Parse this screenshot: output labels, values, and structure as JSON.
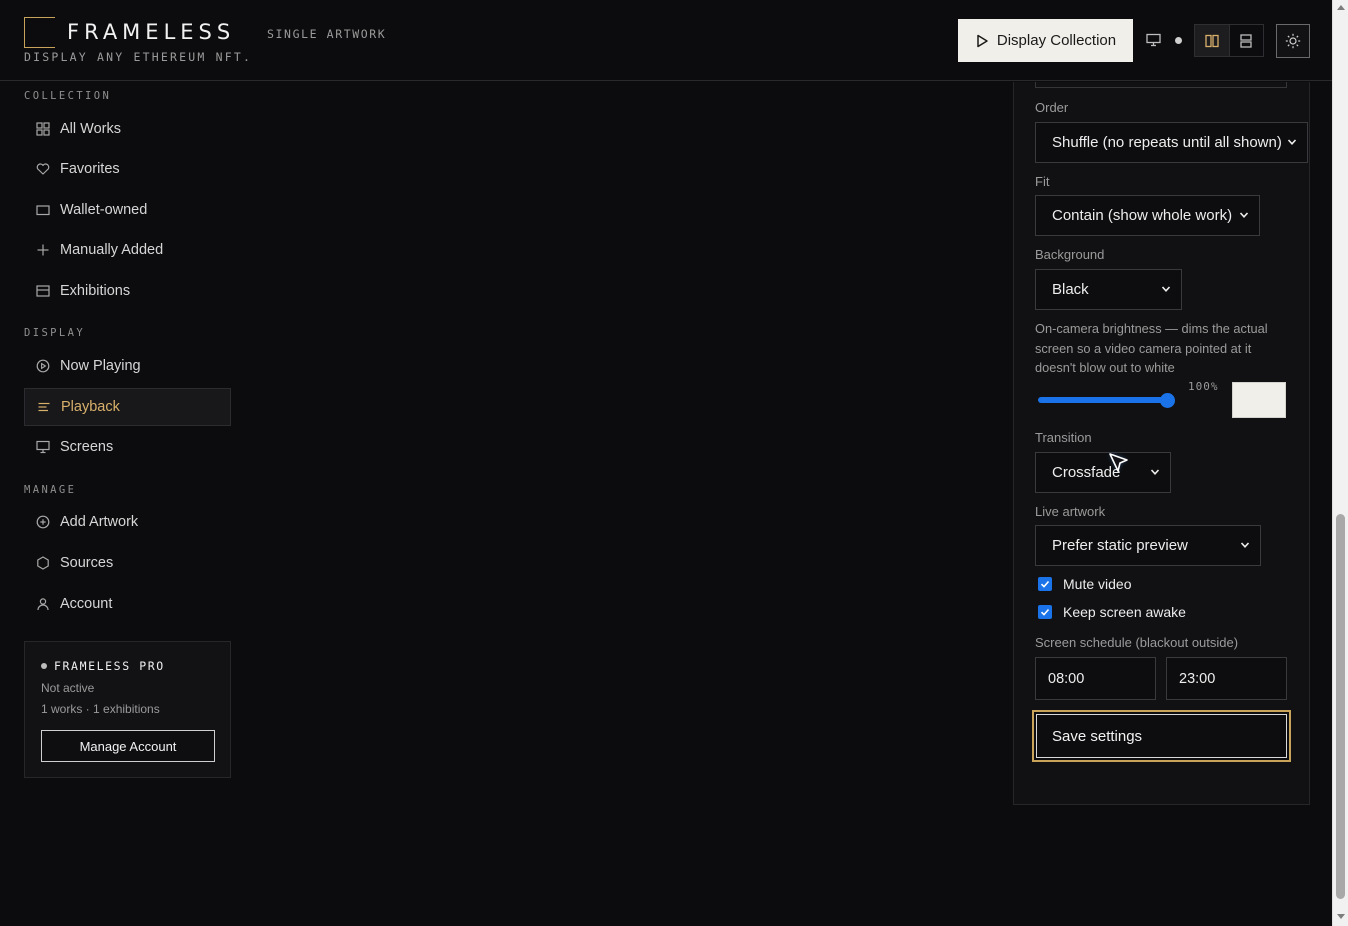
{
  "header": {
    "brand": "FRAMELESS",
    "mode": "SINGLE ARTWORK",
    "tagline": "DISPLAY ANY ETHEREUM NFT.",
    "display_button": "Display Collection",
    "accent_color": "#c8a35a"
  },
  "sidebar": {
    "sections": [
      {
        "title": "COLLECTION"
      },
      {
        "title": "DISPLAY"
      },
      {
        "title": "MANAGE"
      }
    ],
    "items": [
      {
        "label": "All Works",
        "icon": "grid-icon"
      },
      {
        "label": "Favorites",
        "icon": "heart-icon"
      },
      {
        "label": "Wallet-owned",
        "icon": "wallet-icon"
      },
      {
        "label": "Manually Added",
        "icon": "plus-icon"
      },
      {
        "label": "Exhibitions",
        "icon": "exhibition-icon"
      },
      {
        "label": "Now Playing",
        "icon": "play-circle-icon"
      },
      {
        "label": "Playback",
        "icon": "lines-icon",
        "active": true
      },
      {
        "label": "Screens",
        "icon": "monitor-icon"
      },
      {
        "label": "Add Artwork",
        "icon": "plus-circle-icon"
      },
      {
        "label": "Sources",
        "icon": "hexagon-icon"
      },
      {
        "label": "Account",
        "icon": "user-icon"
      }
    ],
    "pro": {
      "title": "FRAMELESS PRO",
      "status": "Not active",
      "stats": "1 works · 1 exhibitions",
      "button": "Manage Account"
    }
  },
  "settings": {
    "order": {
      "label": "Order",
      "value": "Shuffle (no repeats until all shown)"
    },
    "fit": {
      "label": "Fit",
      "value": "Contain (show whole work)"
    },
    "background": {
      "label": "Background",
      "value": "Black"
    },
    "brightness": {
      "description": "On-camera brightness — dims the actual screen so a video camera pointed at it doesn't blow out to white",
      "value_text": "100%",
      "value": 1.0,
      "swatch_color": "#f1efe9"
    },
    "transition": {
      "label": "Transition",
      "value": "Crossfade"
    },
    "live_artwork": {
      "label": "Live artwork",
      "value": "Prefer static preview"
    },
    "mute_video": {
      "label": "Mute video",
      "checked": true
    },
    "keep_awake": {
      "label": "Keep screen awake",
      "checked": true
    },
    "schedule": {
      "label": "Screen schedule (blackout outside)",
      "start": "08:00",
      "end": "23:00"
    },
    "save_button": "Save settings"
  }
}
